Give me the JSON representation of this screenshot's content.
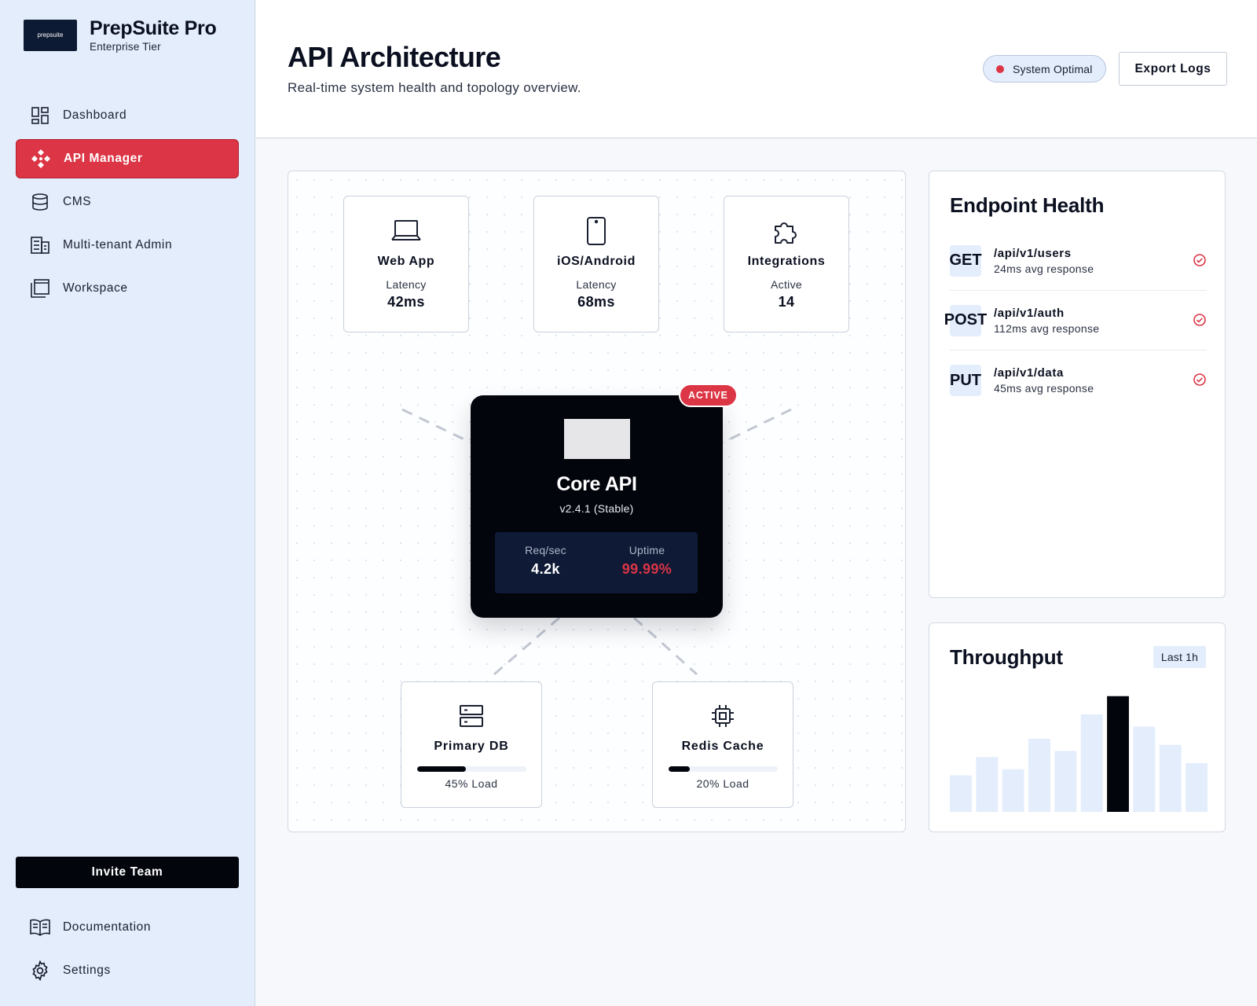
{
  "brand": {
    "logo_text": "prepsuite",
    "title": "PrepSuite Pro",
    "subtitle": "Enterprise Tier"
  },
  "nav": {
    "items": [
      {
        "label": "Dashboard",
        "icon": "dashboard-icon"
      },
      {
        "label": "API Manager",
        "icon": "api-icon",
        "active": true
      },
      {
        "label": "CMS",
        "icon": "database-icon"
      },
      {
        "label": "Multi-tenant Admin",
        "icon": "building-icon"
      },
      {
        "label": "Workspace",
        "icon": "workspace-icon"
      }
    ]
  },
  "invite_label": "Invite Team",
  "bottom_nav": [
    {
      "label": "Documentation",
      "icon": "book-icon"
    },
    {
      "label": "Settings",
      "icon": "gear-icon"
    }
  ],
  "header": {
    "title": "API Architecture",
    "subtitle": "Real-time system health and topology overview.",
    "status": "System Optimal",
    "export_label": "Export Logs"
  },
  "topology": {
    "clients": [
      {
        "name": "Web App",
        "label": "Latency",
        "value": "42ms",
        "icon": "laptop-icon"
      },
      {
        "name": "iOS/Android",
        "label": "Latency",
        "value": "68ms",
        "icon": "phone-icon"
      },
      {
        "name": "Integrations",
        "label": "Active",
        "value": "14",
        "icon": "puzzle-icon"
      }
    ],
    "core": {
      "badge": "ACTIVE",
      "title": "Core API",
      "version": "v2.4.1 (Stable)",
      "stats": [
        {
          "label": "Req/sec",
          "value": "4.2k"
        },
        {
          "label": "Uptime",
          "value": "99.99%"
        }
      ]
    },
    "infra": [
      {
        "name": "Primary DB",
        "load": 45,
        "load_label": "45% Load",
        "icon": "server-icon"
      },
      {
        "name": "Redis Cache",
        "load": 20,
        "load_label": "20% Load",
        "icon": "chip-icon"
      }
    ]
  },
  "endpoints": {
    "title": "Endpoint Health",
    "items": [
      {
        "method": "GET",
        "path": "/api/v1/users",
        "meta": "24ms avg response"
      },
      {
        "method": "POST",
        "path": "/api/v1/auth",
        "meta": "112ms avg response"
      },
      {
        "method": "PUT",
        "path": "/api/v1/data",
        "meta": "45ms avg response"
      }
    ]
  },
  "throughput": {
    "title": "Throughput",
    "range": "Last 1h"
  },
  "chart_data": {
    "type": "bar",
    "values": [
      30,
      45,
      35,
      60,
      50,
      80,
      95,
      70,
      55,
      40
    ],
    "highlight_index": 6,
    "ylim": [
      0,
      100
    ]
  },
  "colors": {
    "accent": "#dc3545",
    "dark": "#03050c",
    "sidebar_bg": "#e3edfc",
    "bar_light": "#e3edfc"
  }
}
